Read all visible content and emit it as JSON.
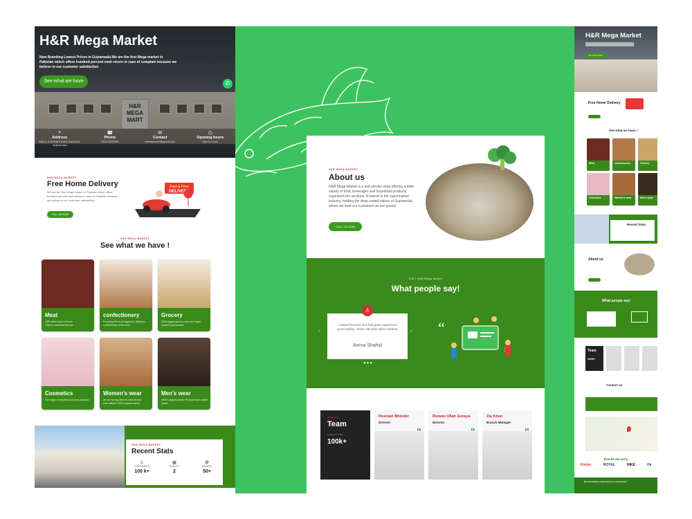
{
  "left": {
    "hero": {
      "title": "H&R Mega Market",
      "text": "Now Branding Lowest Prices in Gujranwala.We are the first Mega market in Pakistan which offers hundred percent cash return in case of complain because we believe in our customer satisfaction",
      "cta": "See what we have",
      "sign": "H&R MEGA MART",
      "info": [
        {
          "icon": "location-icon",
          "title": "Address",
          "value": "Mall 1, 5 Kehrani Road, Kamonki, Gujranwala"
        },
        {
          "icon": "phone-icon",
          "title": "Phone",
          "value": "0300 0000000"
        },
        {
          "icon": "mail-icon",
          "title": "Contact",
          "value": "hrmegamart@gmail.com"
        },
        {
          "icon": "clock-icon",
          "title": "Opening hours",
          "value": "9am to 11pm"
        }
      ]
    },
    "delivery": {
      "tag": "H&R MEGA MARKET",
      "title": "Free Home Delivery",
      "text": "We are the first Mega market in Pakistan which offers hundred percent cash return in case of complain because we believe in our customer satisfaction.",
      "button": "CALL US NOW",
      "badge": "Fast & Free DELIVERY"
    },
    "products": {
      "tag": "H&R MEGA MARKET",
      "title": "See what we have !",
      "items": [
        {
          "label": "Meat",
          "desc": "H&R offers fresh & frozen chicken,meat,beef,fish etc",
          "color": "#6b2a22"
        },
        {
          "label": "confectionery",
          "desc": "Providing the most hygienic & delicious confectionery in the town",
          "color": "#b07a4a"
        },
        {
          "label": "Grocery",
          "desc": "H&R biggest grocery store and super market in gujranwala",
          "color": "#c9a56c"
        },
        {
          "label": "Cosmetics",
          "desc": "Full range of imported and local products",
          "color": "#e7b9c4"
        },
        {
          "label": "Women's wear",
          "desc": "we are having different national and international 100% original brands",
          "color": "#a56b3c"
        },
        {
          "label": "Men's wear",
          "desc": "100% original brands 0% lower than market prices",
          "color": "#3b2a22"
        }
      ]
    },
    "stats": {
      "tag": "H&R MEGA MARKET",
      "title": "Recent Stats",
      "items": [
        {
          "icon": "user-icon",
          "label": "CUSTOMERS",
          "value": "100 k+"
        },
        {
          "icon": "calendar-icon",
          "label": "EVENTS",
          "value": "2"
        },
        {
          "icon": "award-icon",
          "label": "AWARDS",
          "value": "50+"
        }
      ]
    }
  },
  "center": {
    "about": {
      "tag": "H&R MEGA MARKET",
      "title": "About us",
      "text": "H&R Mega Market is a self-service shop offering a wide variety of food, beverages and household products, organized into sections. A marvel in the supermarket industry, holding the deep rooted values of Gujranwala where we treat our customers as our guests.",
      "button": "CALL US NOW"
    },
    "testimonials": {
      "tag": "VISIT H&R Mega Market",
      "title": "What people say!",
      "quote": "I visited first time and had great experience ,good quality , lower rate than other markets.",
      "name": "Amna Shahid",
      "prev": "‹",
      "next": "›",
      "dots": "●●●"
    },
    "team": {
      "tag": "MEGA H&R",
      "title": "Team",
      "clients_label": "CLIENTS TOTAL",
      "clients_value": "100k+",
      "members": [
        {
          "name": "Husnain Bhinder",
          "role": "Director"
        },
        {
          "name": "Rizwan Ullah Goraya",
          "role": "Director"
        },
        {
          "name": "Zia Khan",
          "role": "Branch Manager"
        }
      ]
    }
  },
  "right": {
    "hero_title": "H&R Mega Market",
    "hero_cta": "See what we have",
    "delivery_title": "Free Home Delivery",
    "see_title": "See what we have !",
    "cards": [
      "Meat",
      "confectionery",
      "Grocery",
      "Cosmetics",
      "Women's wear",
      "Men's wear"
    ],
    "stats_title": "Recent Stats",
    "about_title": "About us",
    "say_title": "What people say!",
    "team_title": "Team",
    "team_count": "100k+",
    "contact_title": "Contact us",
    "brands_title": "Brands we carry",
    "brands": [
      "Kinder",
      "ROYAL",
      "NIKE",
      "Pa"
    ],
    "footer_text": "Now Branding Lowest prices in Gujranwala"
  }
}
